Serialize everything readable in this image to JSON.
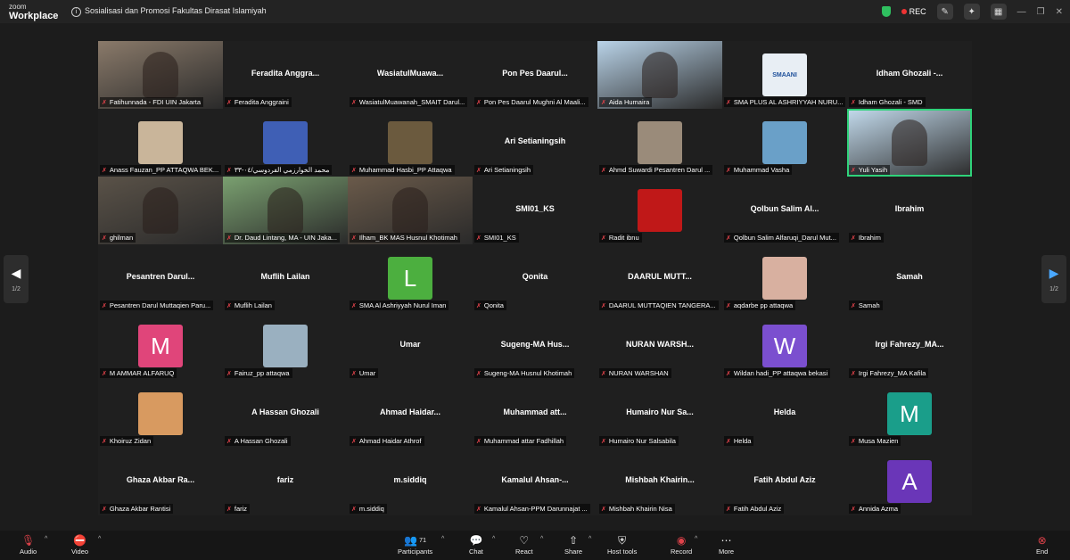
{
  "app": {
    "logo_top": "zoom",
    "logo_bottom": "Workplace",
    "meeting_title": "Sosialisasi dan Promosi Fakultas Dirasat Islamiyah",
    "rec_label": "REC"
  },
  "tiles": [
    {
      "name": "",
      "label": "Fatihunnada - FDI UIN Jakarta",
      "type": "video",
      "color": "#8a7a6a"
    },
    {
      "name": "Feradita Anggra...",
      "label": "Feradita Anggraini",
      "type": "name"
    },
    {
      "name": "WasiatulMuawa...",
      "label": "WasiatulMuawanah_SMAIT Darul...",
      "type": "name"
    },
    {
      "name": "Pon Pes Daarul...",
      "label": "Pon Pes Daarul Mughni Al Maali...",
      "type": "name"
    },
    {
      "name": "",
      "label": "Aida Humaira",
      "type": "video",
      "color": "#b9d3e8"
    },
    {
      "name": "",
      "label": "SMA PLUS AL ASHRIYYAH NURU...",
      "type": "avatar",
      "color": "#e8eef4",
      "text": "SMAANI"
    },
    {
      "name": "Idham Ghozali -...",
      "label": "Idham Ghozali - SMD",
      "type": "name"
    },
    {
      "name": "",
      "label": "Anass Fauzan_PP ATTAQWA BEK...",
      "type": "avatar",
      "color": "#c9b59a",
      "text": ""
    },
    {
      "name": "",
      "label": "محمد الخوارزمي الفردوسي/٠٤-٣٣",
      "type": "avatar",
      "color": "#3f5fb5",
      "text": ""
    },
    {
      "name": "",
      "label": "Muhammad Hasbi_PP Attaqwa",
      "type": "avatar",
      "color": "#6b5a3e",
      "text": ""
    },
    {
      "name": "Ari Setianingsih",
      "label": "Ari Setianingsih",
      "type": "name"
    },
    {
      "name": "",
      "label": "Ahmd Suwardi Pesantren Darul ...",
      "type": "avatar",
      "color": "#9a8b7a",
      "text": ""
    },
    {
      "name": "",
      "label": "Muhammad Vasha",
      "type": "avatar",
      "color": "#6aa0c8",
      "text": ""
    },
    {
      "name": "",
      "label": "Yuli Yasih",
      "type": "video",
      "color": "#c4dcee",
      "active": true
    },
    {
      "name": "",
      "label": "ghilman",
      "type": "video",
      "color": "#5a5248"
    },
    {
      "name": "",
      "label": "Dr. Daud Lintang, MA - UIN Jaka...",
      "type": "video",
      "color": "#7aa070"
    },
    {
      "name": "",
      "label": "Ilham_BK MAS Husnul Khotimah",
      "type": "video",
      "color": "#6a5a4a"
    },
    {
      "name": "SMI01_KS",
      "label": "SMI01_KS",
      "type": "name"
    },
    {
      "name": "",
      "label": "Radit ibnu",
      "type": "avatar",
      "color": "#c01818",
      "text": ""
    },
    {
      "name": "Qolbun Salim Al...",
      "label": "Qolbun Salim Alfaruqi_Darul Mut...",
      "type": "name"
    },
    {
      "name": "Ibrahim",
      "label": "Ibrahim",
      "type": "name"
    },
    {
      "name": "Pesantren Darul...",
      "label": "Pesantren Darul Muttaqien Paru...",
      "type": "name"
    },
    {
      "name": "Muflih Lailan",
      "label": "Muflih Lailan",
      "type": "name"
    },
    {
      "name": "",
      "label": "SMA Al Ashriyyah Nurul Iman",
      "type": "letter",
      "color": "#4caf3f",
      "text": "L"
    },
    {
      "name": "Qonita",
      "label": "Qonita",
      "type": "name"
    },
    {
      "name": "DAARUL MUTT...",
      "label": "DAARUL MUTTAQIEN TANGERA...",
      "type": "name"
    },
    {
      "name": "",
      "label": "aqdarbe pp attaqwa",
      "type": "avatar",
      "color": "#d8b0a0",
      "text": ""
    },
    {
      "name": "Samah",
      "label": "Samah",
      "type": "name"
    },
    {
      "name": "",
      "label": "M AMMAR ALFARUQ",
      "type": "letter",
      "color": "#e0457a",
      "text": "M"
    },
    {
      "name": "",
      "label": "Fairuz_pp attaqwa",
      "type": "avatar",
      "color": "#9ab0c0",
      "text": ""
    },
    {
      "name": "Umar",
      "label": "Umar",
      "type": "name"
    },
    {
      "name": "Sugeng-MA Hus...",
      "label": "Sugeng-MA Husnul Khotimah",
      "type": "name"
    },
    {
      "name": "NURAN WARSH...",
      "label": "NURAN WARSHAN",
      "type": "name"
    },
    {
      "name": "",
      "label": "Wildan hadi_PP attaqwa bekasi",
      "type": "letter",
      "color": "#7b4fcf",
      "text": "W"
    },
    {
      "name": "Irgi Fahrezy_MA...",
      "label": "Irgi Fahrezy_MA Kafila",
      "type": "name"
    },
    {
      "name": "",
      "label": "Khoiruz Zidan",
      "type": "avatar",
      "color": "#d89a60",
      "text": ""
    },
    {
      "name": "A Hassan Ghozali",
      "label": "A Hassan Ghozali",
      "type": "name"
    },
    {
      "name": "Ahmad Haidar...",
      "label": "Ahmad Haidar Athrof",
      "type": "name"
    },
    {
      "name": "Muhammad att...",
      "label": "Muhammad attar Fadhillah",
      "type": "name"
    },
    {
      "name": "Humairo Nur Sa...",
      "label": "Humairo Nur Salsabila",
      "type": "name"
    },
    {
      "name": "Helda",
      "label": "Helda",
      "type": "name"
    },
    {
      "name": "",
      "label": "Musa Mazien",
      "type": "letter",
      "color": "#1a9e8a",
      "text": "M"
    },
    {
      "name": "Ghaza Akbar Ra...",
      "label": "Ghaza Akbar Rantisi",
      "type": "name"
    },
    {
      "name": "fariz",
      "label": "fariz",
      "type": "name"
    },
    {
      "name": "m.siddiq",
      "label": "m.siddiq",
      "type": "name"
    },
    {
      "name": "Kamalul Ahsan-...",
      "label": "Kamalul Ahsan-PPM Darunnajat ...",
      "type": "name"
    },
    {
      "name": "Mishbah Khairin...",
      "label": "Mishbah Khairin Nisa",
      "type": "name"
    },
    {
      "name": "Fatih Abdul Aziz",
      "label": "Fatih Abdul Aziz",
      "type": "name"
    },
    {
      "name": "",
      "label": "Annida Azma",
      "type": "letter",
      "color": "#6a36b8",
      "text": "A"
    }
  ],
  "nav": {
    "prev_arrow": "◀",
    "next_arrow": "▶",
    "page_left": "1/2",
    "page_right": "1/2"
  },
  "toolbar": {
    "audio": "Audio",
    "video": "Video",
    "participants": "Participants",
    "participants_count": "71",
    "chat": "Chat",
    "react": "React",
    "share": "Share",
    "host_tools": "Host tools",
    "record": "Record",
    "more": "More",
    "end": "End"
  },
  "icons": [
    "info-icon",
    "shield-icon",
    "record-dot-icon",
    "edit-icon",
    "sparkle-icon",
    "grid-icon",
    "minimize-icon",
    "maximize-icon",
    "close-icon",
    "mic-muted-icon",
    "video-off-icon",
    "participants-icon",
    "chat-icon",
    "react-icon",
    "share-icon",
    "host-tools-icon",
    "record-icon",
    "more-icon",
    "end-icon"
  ]
}
